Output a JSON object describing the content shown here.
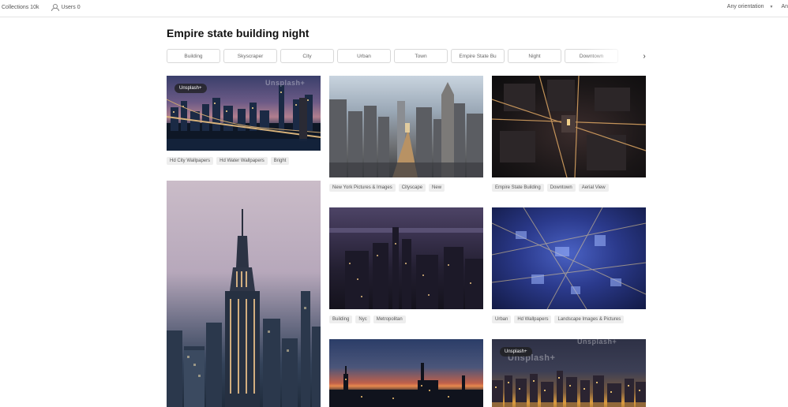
{
  "topbar": {
    "collections_label": "Collections 10k",
    "users_label": "Users 0",
    "orientation_label": "Any orientation",
    "right_cut_label": "An"
  },
  "page": {
    "title": "Empire state building night"
  },
  "chips": [
    "Building",
    "Skyscraper",
    "City",
    "Urban",
    "Town",
    "Empire State Bu",
    "Night",
    "Downtown"
  ],
  "photos": [
    {
      "badge": "Unsplash+",
      "watermark": "Unsplash+",
      "tags": [
        "Hd City Wallpapers",
        "Hd Water Wallpapers",
        "Bright"
      ]
    },
    {
      "tags": [
        "New York Pictures & Images",
        "Cityscape",
        "New"
      ]
    },
    {
      "tags": [
        "Empire State Building",
        "Downtown",
        "Aerial View"
      ]
    },
    {
      "tags": []
    },
    {
      "tags": [
        "Building",
        "Nyc",
        "Metropolitan"
      ]
    },
    {
      "tags": [
        "Urban",
        "Hd Wallpapers",
        "Landscape Images & Pictures"
      ]
    },
    {
      "tags": []
    },
    {
      "badge": "Unsplash+",
      "watermark": "Unsplash+",
      "tags": []
    }
  ]
}
